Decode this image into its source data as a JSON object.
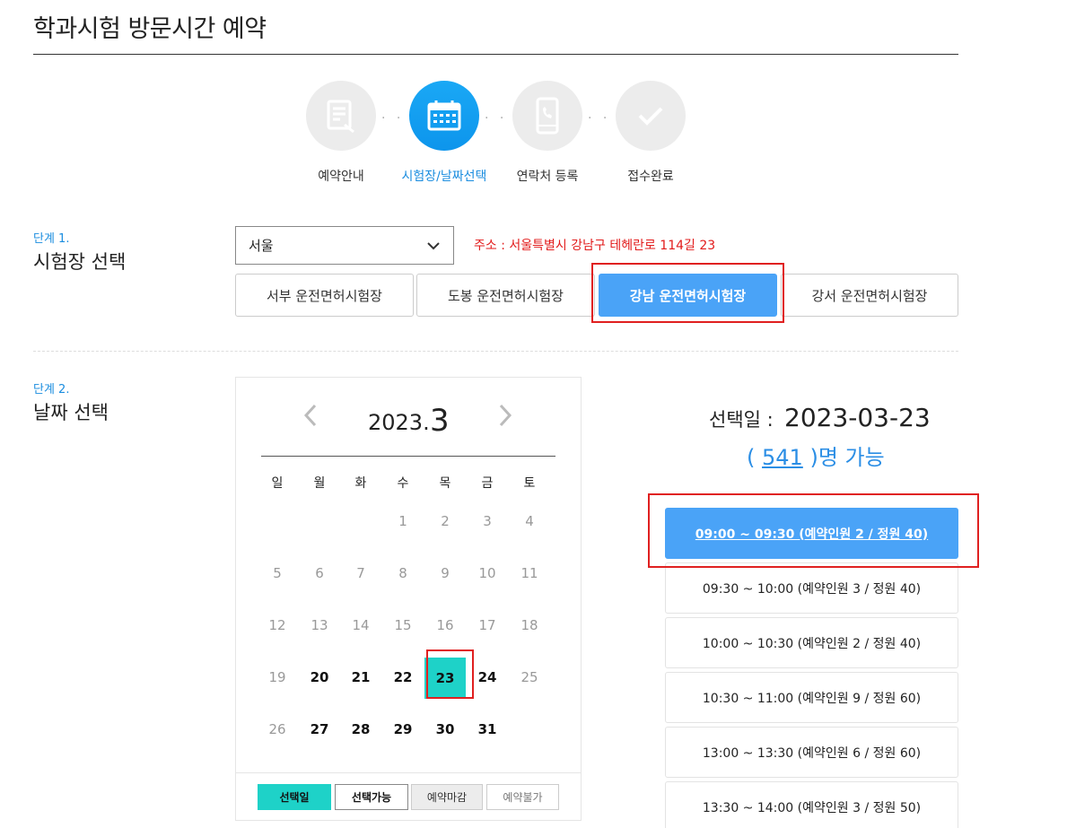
{
  "page": {
    "title": "학과시험 방문시간 예약"
  },
  "steps": [
    {
      "label": "예약안내",
      "icon": "document-edit-icon",
      "active": false
    },
    {
      "label": "시험장/날짜선택",
      "icon": "calendar-icon",
      "active": true
    },
    {
      "label": "연락처 등록",
      "icon": "phone-icon",
      "active": false
    },
    {
      "label": "접수완료",
      "icon": "check-icon",
      "active": false
    }
  ],
  "stage1": {
    "step": "단계 1.",
    "title": "시험장 선택",
    "region": "서울",
    "address": "주소 : 서울특별시 강남구 테헤란로 114길 23",
    "centers": [
      "서부 운전면허시험장",
      "도봉 운전면허시험장",
      "강남 운전면허시험장",
      "강서 운전면허시험장"
    ],
    "selected_center": "강남 운전면허시험장"
  },
  "stage2": {
    "step": "단계 2.",
    "title": "날짜 선택",
    "calendar": {
      "year": "2023.",
      "month": "3",
      "weekdays": [
        "일",
        "월",
        "화",
        "수",
        "목",
        "금",
        "토"
      ],
      "weeks": [
        [
          "",
          "",
          "",
          "1",
          "2",
          "3",
          "4"
        ],
        [
          "5",
          "6",
          "7",
          "8",
          "9",
          "10",
          "11"
        ],
        [
          "12",
          "13",
          "14",
          "15",
          "16",
          "17",
          "18"
        ],
        [
          "19",
          "20",
          "21",
          "22",
          "23",
          "24",
          "25"
        ],
        [
          "26",
          "27",
          "28",
          "29",
          "30",
          "31",
          ""
        ]
      ],
      "available_days": [
        "20",
        "21",
        "22",
        "24",
        "27",
        "28",
        "29",
        "30",
        "31"
      ],
      "selected_day": "23",
      "legend": [
        "선택일",
        "선택가능",
        "예약마감",
        "예약불가"
      ]
    },
    "selected_label": "선택일 :",
    "selected_date": "2023-03-23",
    "capacity": {
      "open": "(",
      "count": "541",
      "close": ")명 가능"
    },
    "slots": [
      "09:00 ~ 09:30 (예약인원 2 / 정원 40)",
      "09:30 ~ 10:00 (예약인원 3 / 정원 40)",
      "10:00 ~ 10:30 (예약인원 2 / 정원 40)",
      "10:30 ~ 11:00 (예약인원 9 / 정원 60)",
      "13:00 ~ 13:30 (예약인원 6 / 정원 60)",
      "13:30 ~ 14:00 (예약인원 3 / 정원 50)"
    ],
    "selected_slot": "09:00 ~ 09:30 (예약인원 2 / 정원 40)"
  },
  "colors": {
    "accent": "#1b8ddf",
    "selected_button": "#4aa3f7",
    "selected_day": "#1ed2c8",
    "highlight_box": "#e02020",
    "address": "#e21b1b"
  }
}
